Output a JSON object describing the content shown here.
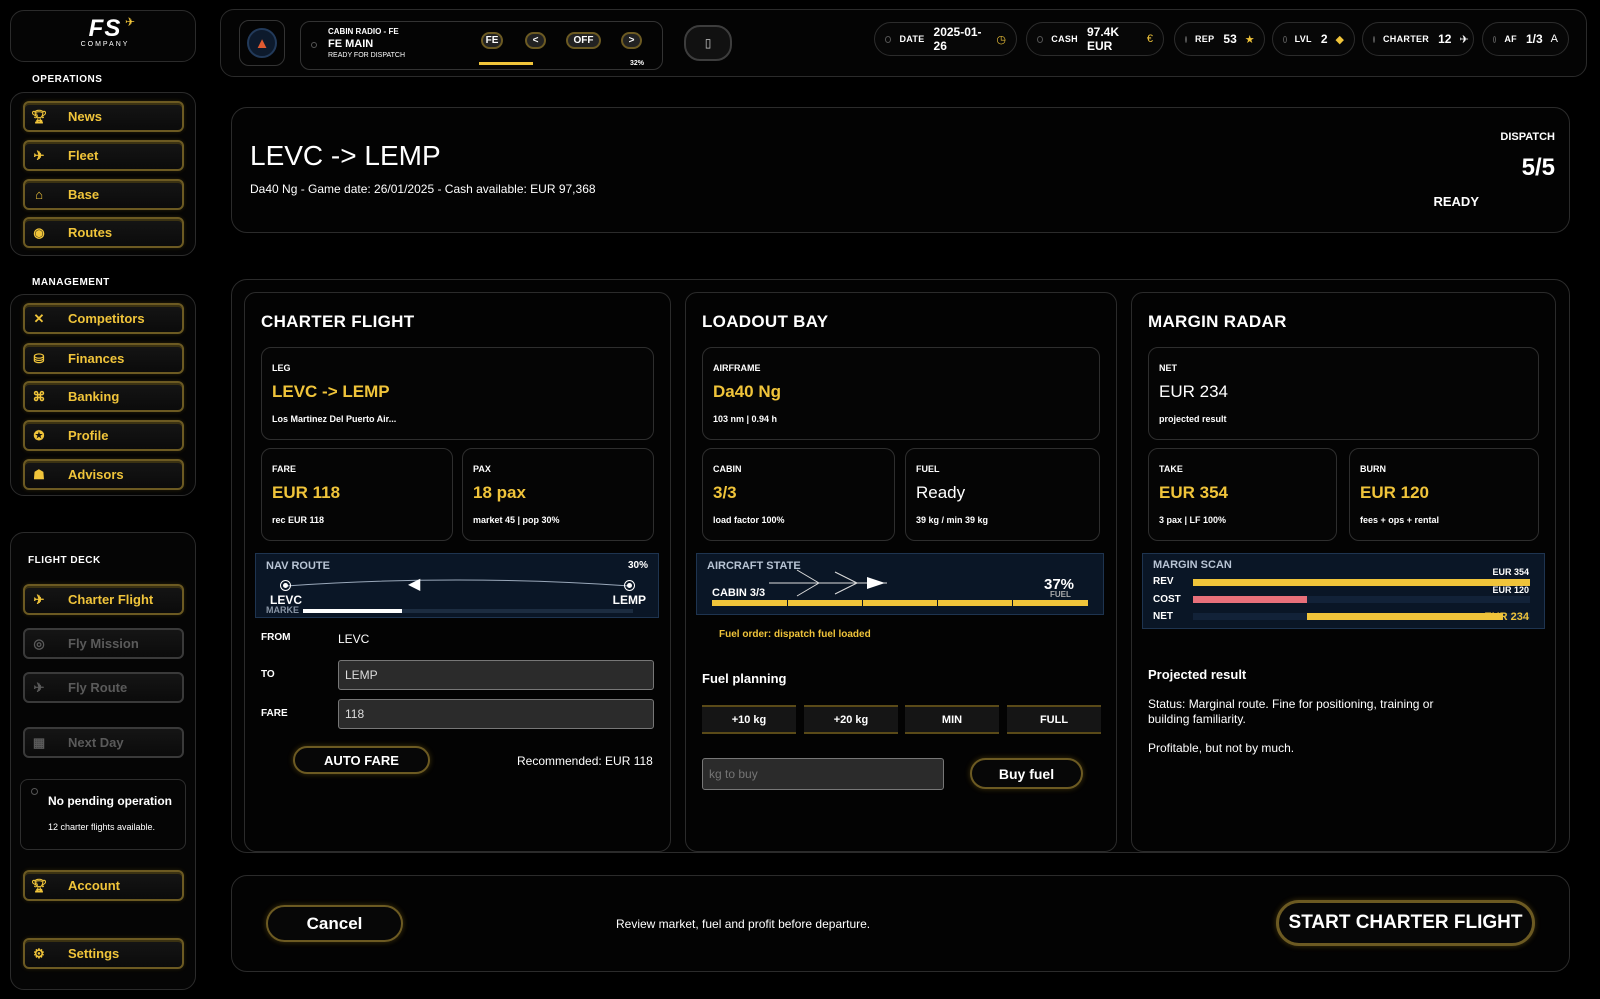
{
  "logo": {
    "text": "FS",
    "sub": "COMPANY"
  },
  "sidebar": {
    "operations_heading": "OPERATIONS",
    "operations": [
      {
        "label": "News",
        "icon": "trophy-icon"
      },
      {
        "label": "Fleet",
        "icon": "plane-icon"
      },
      {
        "label": "Base",
        "icon": "hangar-icon"
      },
      {
        "label": "Routes",
        "icon": "globe-icon"
      }
    ],
    "management_heading": "MANAGEMENT",
    "management": [
      {
        "label": "Competitors",
        "icon": "crossed-planes-icon"
      },
      {
        "label": "Finances",
        "icon": "coins-icon"
      },
      {
        "label": "Banking",
        "icon": "bank-icon"
      },
      {
        "label": "Profile",
        "icon": "badge-icon"
      },
      {
        "label": "Advisors",
        "icon": "advisor-icon"
      }
    ],
    "flightdeck_heading": "FLIGHT DECK",
    "flightdeck": [
      {
        "label": "Charter Flight",
        "icon": "plane-icon",
        "enabled": true
      },
      {
        "label": "Fly Mission",
        "icon": "target-icon",
        "enabled": false
      },
      {
        "label": "Fly Route",
        "icon": "route-plane-icon",
        "enabled": false
      },
      {
        "label": "Next Day",
        "icon": "calendar-icon",
        "enabled": false
      }
    ],
    "pending": {
      "title": "No pending operation",
      "sub": "12 charter flights available."
    },
    "account": "Account",
    "settings": "Settings"
  },
  "topbar": {
    "radio": {
      "title": "CABIN RADIO - FE",
      "main": "FE MAIN",
      "status": "READY FOR DISPATCH",
      "buttons": [
        "FE",
        "<",
        "OFF",
        ">"
      ],
      "percent": "32%",
      "progress": 0.32
    },
    "stats": [
      {
        "key": "DATE",
        "value": "2025-01-26",
        "glyph": "◷"
      },
      {
        "key": "CASH",
        "value": "97.4K EUR",
        "glyph": "€"
      },
      {
        "key": "REP",
        "value": "53",
        "glyph": "★"
      },
      {
        "key": "LVL",
        "value": "2",
        "glyph": "◆"
      },
      {
        "key": "CHARTER",
        "value": "12",
        "glyph": "✈"
      },
      {
        "key": "AF",
        "value": "1/3",
        "glyph": "A"
      }
    ]
  },
  "header": {
    "route": "LEVC -> LEMP",
    "subtitle": "Da40 Ng - Game date: 26/01/2025 - Cash available: EUR 97,368",
    "dispatch_label": "DISPATCH",
    "dispatch_value": "5/5",
    "dispatch_status": "READY"
  },
  "charter": {
    "title": "CHARTER FLIGHT",
    "leg": {
      "k": "LEG",
      "v": "LEVC -> LEMP",
      "s": "Los Martinez Del Puerto Air..."
    },
    "fare": {
      "k": "FARE",
      "v": "EUR 118",
      "s": "rec EUR 118"
    },
    "pax": {
      "k": "PAX",
      "v": "18 pax",
      "s": "market 45 | pop 30%"
    },
    "nav": {
      "label": "NAV ROUTE",
      "percent": "30%",
      "from": "LEVC",
      "to": "LEMP",
      "marker": "MARKE",
      "progress": 0.3
    },
    "form": {
      "from_label": "FROM",
      "from_value": "LEVC",
      "to_label": "TO",
      "to_value": "LEMP",
      "fare_label": "FARE",
      "fare_value": "118"
    },
    "auto_fare": "AUTO FARE",
    "recommended": "Recommended: EUR 118"
  },
  "loadout": {
    "title": "LOADOUT BAY",
    "airframe": {
      "k": "AIRFRAME",
      "v": "Da40 Ng",
      "s": "103 nm | 0.94 h"
    },
    "cabin": {
      "k": "CABIN",
      "v": "3/3",
      "s": "load factor 100%"
    },
    "fuel": {
      "k": "FUEL",
      "v": "Ready",
      "s": "39 kg / min 39 kg"
    },
    "state": {
      "label": "AIRCRAFT STATE",
      "cabin": "CABIN 3/3",
      "percent": "37%",
      "fuel_tag": "FUEL"
    },
    "fuel_order": "Fuel order: dispatch fuel loaded",
    "planning_title": "Fuel planning",
    "buttons": [
      "+10 kg",
      "+20 kg",
      "MIN",
      "FULL"
    ],
    "kg_placeholder": "kg to buy",
    "buy": "Buy fuel"
  },
  "margin": {
    "title": "MARGIN RADAR",
    "net": {
      "k": "NET",
      "v": "EUR 234",
      "s": "projected result"
    },
    "take": {
      "k": "TAKE",
      "v": "EUR 354",
      "s": "3 pax | LF 100%"
    },
    "burn": {
      "k": "BURN",
      "v": "EUR 120",
      "s": "fees + ops + rental"
    },
    "scan": {
      "label": "MARGIN SCAN",
      "rows": [
        {
          "label": "REV",
          "value": "EUR 354",
          "amount": 354
        },
        {
          "label": "COST",
          "value": "EUR 120",
          "amount": 120
        },
        {
          "label": "NET",
          "value": "EUR 234",
          "amount": 234
        }
      ]
    },
    "projected_title": "Projected result",
    "status": "Status: Marginal route. Fine for positioning, training or building familiarity.",
    "note": "Profitable, but not by much."
  },
  "footer": {
    "cancel": "Cancel",
    "message": "Review market, fuel and profit before departure.",
    "start": "START CHARTER FLIGHT"
  },
  "colors": {
    "accent": "#f0c43a",
    "cost": "#e8707a",
    "nav_bg": "#0a1626"
  }
}
